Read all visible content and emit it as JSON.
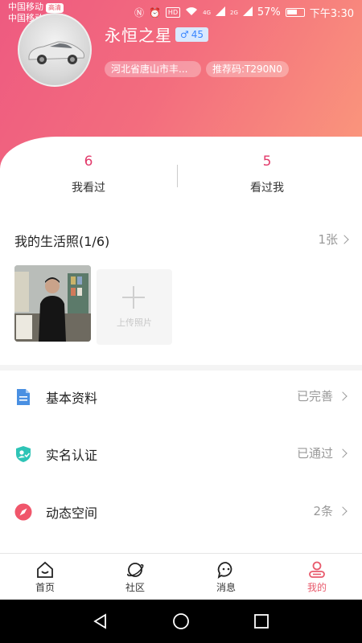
{
  "status_bar": {
    "carrier_1": "中国移动",
    "carrier_2": "中国移动",
    "carrier_badge": "高清",
    "net_4g": "4G",
    "net_2g": "2G",
    "battery": "57%",
    "time": "下午3:30"
  },
  "profile": {
    "name": "永恒之星",
    "gender_symbol": "♂",
    "age": "45",
    "location": "河北省唐山市丰...",
    "referral": "推荐码:T290N0"
  },
  "stats": {
    "viewed_count": "6",
    "viewed_label": "我看过",
    "viewer_count": "5",
    "viewer_label": "看过我"
  },
  "photos": {
    "title": "我的生活照(1/6)",
    "count": "1张",
    "upload_label": "上传照片"
  },
  "menu": [
    {
      "label": "基本资料",
      "status": "已完善",
      "icon": "document-icon",
      "color": "#4a90e2"
    },
    {
      "label": "实名认证",
      "status": "已通过",
      "icon": "verified-user-icon",
      "color": "#2ec4b6"
    },
    {
      "label": "动态空间",
      "status": "2条",
      "icon": "compass-icon",
      "color": "#f0566b"
    }
  ],
  "nav": {
    "home": "首页",
    "community": "社区",
    "messages": "消息",
    "mine": "我的"
  },
  "colors": {
    "accent": "#e85a6c",
    "gradient_start": "#ee5a80",
    "gradient_end": "#fb9a7c",
    "count_color": "#e23a6b"
  }
}
